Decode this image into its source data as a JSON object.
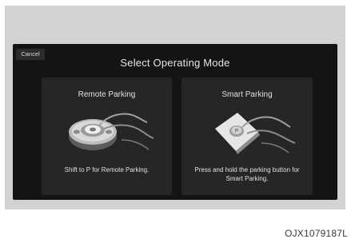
{
  "screen": {
    "cancel_label": "Cancel",
    "title": "Select Operating Mode"
  },
  "options": [
    {
      "title": "Remote Parking",
      "description": "Shift to P for Remote Parking.",
      "icon": "remote-key-icon"
    },
    {
      "title": "Smart Parking",
      "description": "Press and hold the parking button for Smart Parking.",
      "icon": "parking-button-icon"
    }
  ],
  "figure_code": "OJX1079187L",
  "colors": {
    "frame": "#d2d2d2",
    "screen_background": "#141414",
    "card_background": "#262626",
    "text": "#e0e0e0"
  }
}
